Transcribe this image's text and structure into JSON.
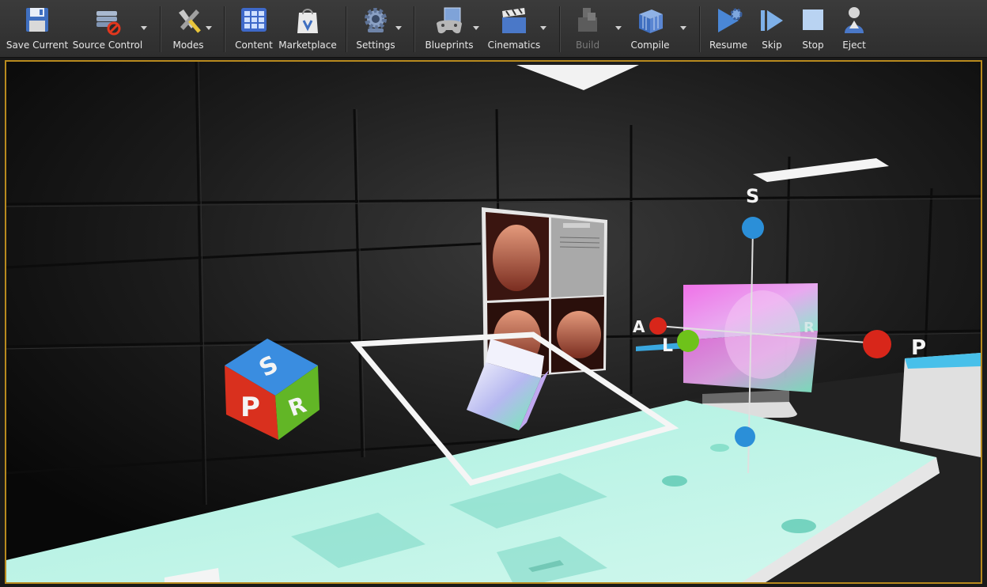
{
  "toolbar": {
    "save_current": "Save Current",
    "source_control": "Source Control",
    "modes": "Modes",
    "content": "Content",
    "marketplace": "Marketplace",
    "settings": "Settings",
    "blueprints": "Blueprints",
    "cinematics": "Cinematics",
    "build": "Build",
    "compile": "Compile",
    "resume": "Resume",
    "skip": "Skip",
    "stop": "Stop",
    "eject": "Eject"
  },
  "viewport": {
    "axis_labels": {
      "superior": "S",
      "anterior": "A",
      "left": "L",
      "posterior": "P",
      "right": "R"
    },
    "cube_faces": {
      "top": "S",
      "front": "P",
      "right": "R"
    }
  },
  "colors": {
    "viewport_border": "#b88a1e",
    "axis_blue": "#2b8fd8",
    "axis_red": "#d8261a",
    "axis_green": "#6ec21a",
    "table_cyan": "#b9f3e6"
  }
}
